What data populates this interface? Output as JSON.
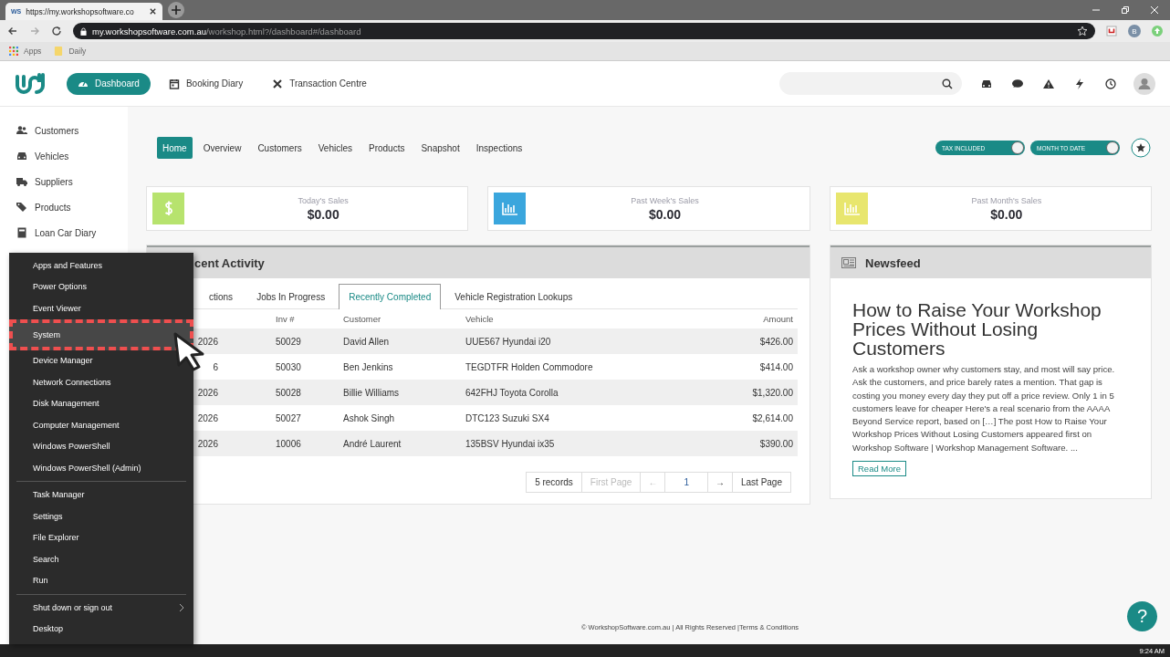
{
  "browser": {
    "tab_favicon": "WS",
    "tab_title": "https://my.workshopsoftware.co",
    "url_host": "my.workshopsoftware.com.au",
    "url_path": "/workshop.html?/dashboard#/dashboard",
    "bookmarks": [
      "Apps",
      "Daily"
    ],
    "profile": "B"
  },
  "nav": [
    {
      "label": "Dashboard",
      "selected": true
    },
    {
      "label": "Booking Diary",
      "selected": false
    },
    {
      "label": "Transaction Centre",
      "selected": false
    }
  ],
  "sidebar": {
    "items": [
      {
        "label": "Customers"
      },
      {
        "label": "Vehicles"
      },
      {
        "label": "Suppliers"
      },
      {
        "label": "Products"
      },
      {
        "label": "Loan Car Diary"
      }
    ]
  },
  "dash_tabs": [
    {
      "label": "Home",
      "selected": true
    },
    {
      "label": "Overview",
      "selected": false
    },
    {
      "label": "Customers",
      "selected": false
    },
    {
      "label": "Vehicles",
      "selected": false
    },
    {
      "label": "Products",
      "selected": false
    },
    {
      "label": "Snapshot",
      "selected": false
    },
    {
      "label": "Inspections",
      "selected": false
    }
  ],
  "toggles": [
    {
      "label": "TAX INCLUDED",
      "on": true
    },
    {
      "label": "MONTH TO DATE",
      "on": true
    }
  ],
  "stats": [
    {
      "title": "Today's Sales",
      "value": "$0.00",
      "kind": "dollar",
      "color": "#b7e36e"
    },
    {
      "title": "Past Week's Sales",
      "value": "$0.00",
      "kind": "chart",
      "color": "#3aa6dd"
    },
    {
      "title": "Past Month's Sales",
      "value": "$0.00",
      "kind": "chart",
      "color": "#e8e66e"
    }
  ],
  "recent_activity": {
    "title": "cent Activity",
    "tabs": [
      {
        "label": "ctions",
        "selected": false
      },
      {
        "label": "Jobs In Progress",
        "selected": false
      },
      {
        "label": "Recently Completed",
        "selected": true
      },
      {
        "label": "Vehicle Registration Lookups",
        "selected": false
      }
    ],
    "table": {
      "columns": [
        "Inv #",
        "Customer",
        "Vehicle",
        "Amount"
      ],
      "rows": [
        {
          "column_1": "2026",
          "inv": "50029",
          "customer": "David Allen",
          "vehicle": "UUE567 Hyundai i20",
          "amount": "$426.00"
        },
        {
          "column_1": "6",
          "inv": "50030",
          "customer": "Ben Jenkins",
          "vehicle": "TEGDTFR Holden Commodore",
          "amount": "$414.00"
        },
        {
          "column_1": "2026",
          "inv": "50028",
          "customer": "Billie Williams",
          "vehicle": "642FHJ Toyota Corolla",
          "amount": "$1,320.00"
        },
        {
          "column_1": "2026",
          "inv": "50027",
          "customer": "Ashok Singh",
          "vehicle": "DTC123 Suzuki SX4",
          "amount": "$2,614.00"
        },
        {
          "column_1": "2026",
          "inv": "10006",
          "customer": "André Laurent",
          "vehicle": "135BSV Hyundai ix35",
          "amount": "$390.00"
        }
      ]
    },
    "pager": {
      "records": "5 records",
      "first": "First Page",
      "first_disabled": true,
      "prev": "←",
      "page": "1",
      "next": "→",
      "last": "Last Page"
    }
  },
  "newsfeed": {
    "title": "Newsfeed",
    "article_title": "How to Raise Your Workshop Prices Without Losing Customers",
    "article_body": "Ask a workshop owner why customers stay, and most will say price. Ask the customers, and price barely rates a mention. That gap is costing you money every day they put off a price review. Only 1 in 5 customers leave for cheaper Here's a real scenario from the AAAA Beyond Service report, based on […] The post How to Raise Your Workshop Prices Without Losing Customers appeared first on Workshop Software | Workshop Management Software. ...",
    "button": "Read More"
  },
  "footer": "© WorkshopSoftware.com.au | All Rights Reserved |Terms & Conditions",
  "help": "?",
  "context_menu": {
    "sections": [
      {
        "items": [
          {
            "label": "Apps and Features",
            "selected": false,
            "has_submenu": false
          },
          {
            "label": "Power Options",
            "selected": false,
            "has_submenu": false
          },
          {
            "label": "Event Viewer",
            "selected": false,
            "has_submenu": false
          },
          {
            "label": "System",
            "selected": true,
            "has_submenu": false
          },
          {
            "label": "Device Manager",
            "selected": false,
            "has_submenu": false
          },
          {
            "label": "Network Connections",
            "selected": false,
            "has_submenu": false
          },
          {
            "label": "Disk Management",
            "selected": false,
            "has_submenu": false
          },
          {
            "label": "Computer Management",
            "selected": false,
            "has_submenu": false
          },
          {
            "label": "Windows PowerShell",
            "selected": false,
            "has_submenu": false
          },
          {
            "label": "Windows PowerShell (Admin)",
            "selected": false,
            "has_submenu": false
          }
        ]
      },
      {
        "items": [
          {
            "label": "Task Manager",
            "selected": false,
            "has_submenu": false
          },
          {
            "label": "Settings",
            "selected": false,
            "has_submenu": false
          },
          {
            "label": "File Explorer",
            "selected": false,
            "has_submenu": false
          },
          {
            "label": "Search",
            "selected": false,
            "has_submenu": false
          },
          {
            "label": "Run",
            "selected": false,
            "has_submenu": false
          }
        ]
      },
      {
        "items": [
          {
            "label": "Shut down or sign out",
            "selected": false,
            "has_submenu": true
          },
          {
            "label": "Desktop",
            "selected": false,
            "has_submenu": false
          }
        ]
      }
    ]
  },
  "taskbar": {
    "time": "9:24 AM"
  }
}
